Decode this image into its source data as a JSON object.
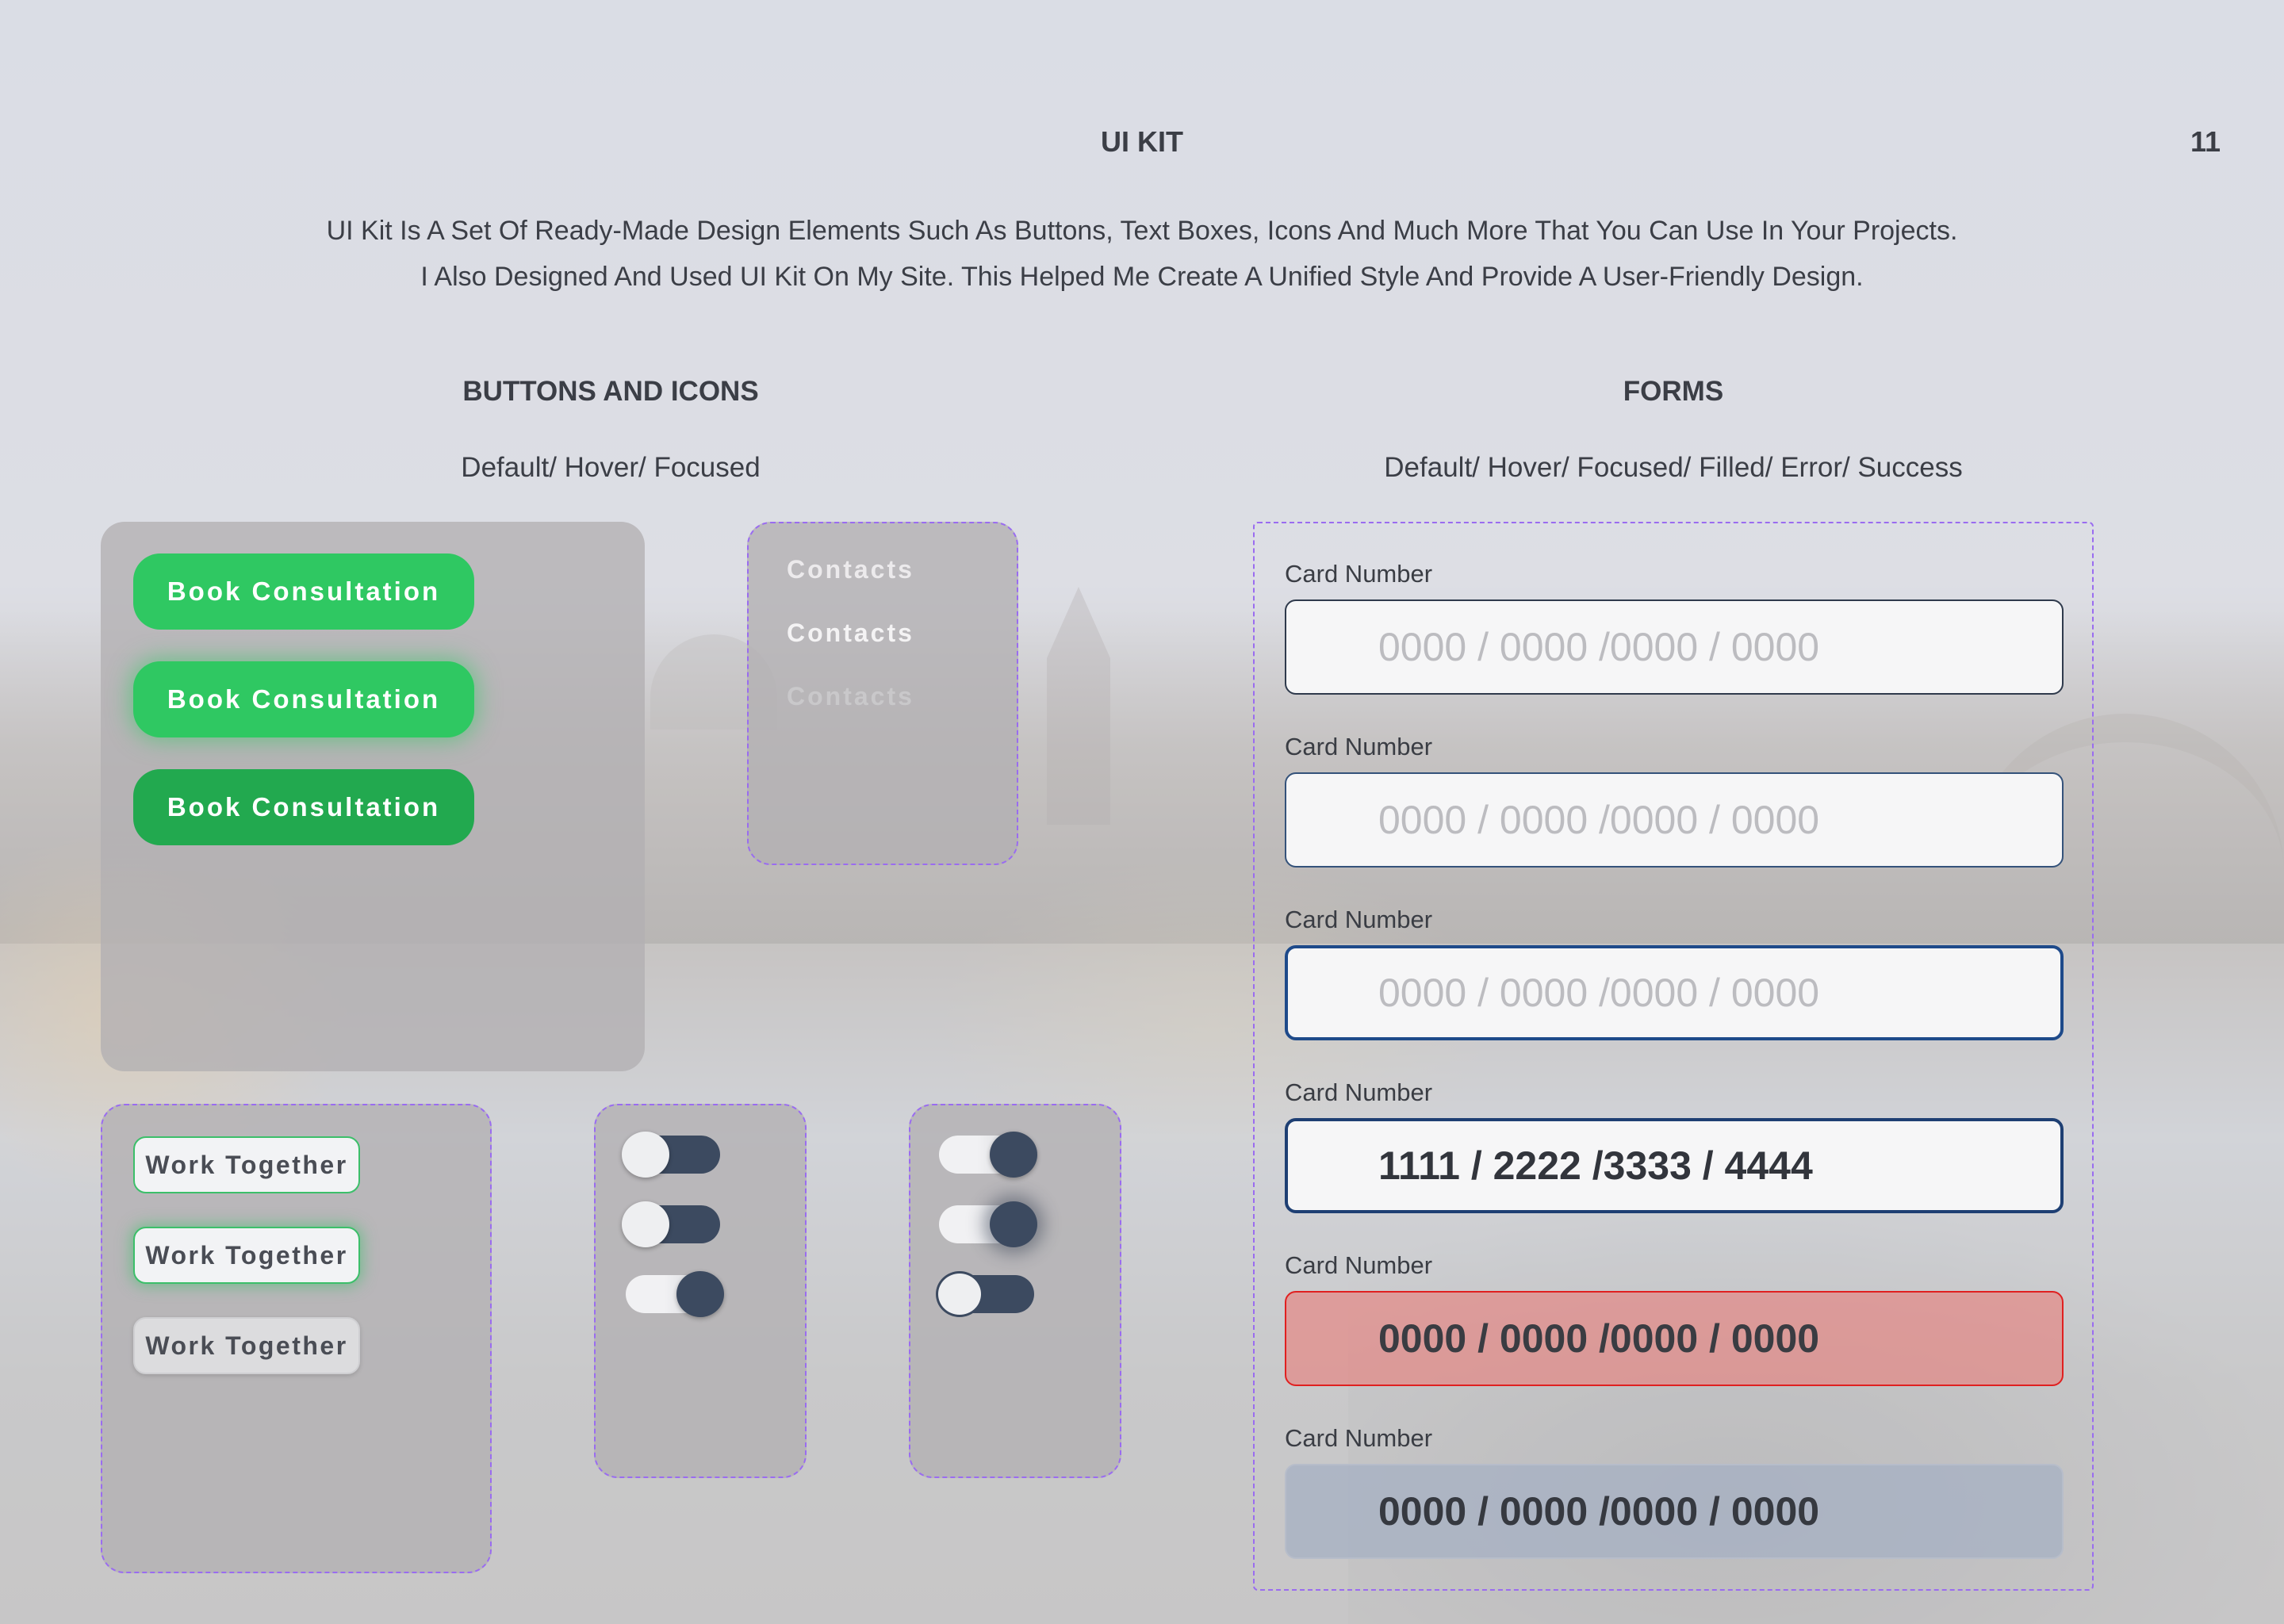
{
  "header": {
    "title": "UI KIT",
    "page_number": "11"
  },
  "intro": {
    "line1": "UI Kit Is A Set Of Ready-Made Design Elements Such As Buttons, Text Boxes, Icons And Much More That You Can Use In Your Projects.",
    "line2": "I Also Designed And Used UI Kit On My Site. This Helped Me Create A Unified Style And Provide A User-Friendly Design."
  },
  "buttons_section": {
    "title": "BUTTONS AND ICONS",
    "states": "Default/ Hover/ Focused",
    "primary_buttons": [
      {
        "label": "Book Consultation",
        "state": "default"
      },
      {
        "label": "Book Consultation",
        "state": "hover"
      },
      {
        "label": "Book Consultation",
        "state": "focused"
      }
    ],
    "contact_links": [
      {
        "label": "Contacts",
        "state": "default"
      },
      {
        "label": "Contacts",
        "state": "hover"
      },
      {
        "label": "Contacts",
        "state": "focused"
      }
    ],
    "secondary_buttons": [
      {
        "label": "Work Together",
        "state": "default"
      },
      {
        "label": "Work Together",
        "state": "hover"
      },
      {
        "label": "Work Together",
        "state": "focused"
      }
    ],
    "toggles_left": [
      {
        "checked": false,
        "state": "default"
      },
      {
        "checked": false,
        "state": "hover"
      },
      {
        "checked": true,
        "state": "focused"
      }
    ],
    "toggles_right": [
      {
        "checked": true,
        "state": "default"
      },
      {
        "checked": true,
        "state": "hover"
      },
      {
        "checked": false,
        "state": "focused"
      }
    ]
  },
  "forms_section": {
    "title": "FORMS",
    "states": "Default/ Hover/ Focused/ Filled/ Error/ Success",
    "fields": [
      {
        "label": "Card Number",
        "state": "default",
        "placeholder": "0000 / 0000 /0000 / 0000",
        "value": ""
      },
      {
        "label": "Card Number",
        "state": "hover",
        "placeholder": "0000 / 0000 /0000 / 0000",
        "value": ""
      },
      {
        "label": "Card Number",
        "state": "focused",
        "placeholder": "0000 / 0000 /0000 / 0000",
        "value": ""
      },
      {
        "label": "Card Number",
        "state": "filled",
        "placeholder": "",
        "value": "1111 / 2222 /3333 / 4444"
      },
      {
        "label": "Card Number",
        "state": "error",
        "placeholder": "",
        "value": "0000 / 0000 /0000 / 0000"
      },
      {
        "label": "Card Number",
        "state": "success",
        "placeholder": "",
        "value": "0000 / 0000 /0000 / 0000"
      }
    ]
  },
  "colors": {
    "primary_green": "#2fc862",
    "primary_green_focused": "#22a94f",
    "toggle_dark": "#3c4a60",
    "field_focus_border": "#1e4a8a",
    "error_border": "#e02020",
    "dashed_outline": "#9a6cf0"
  }
}
